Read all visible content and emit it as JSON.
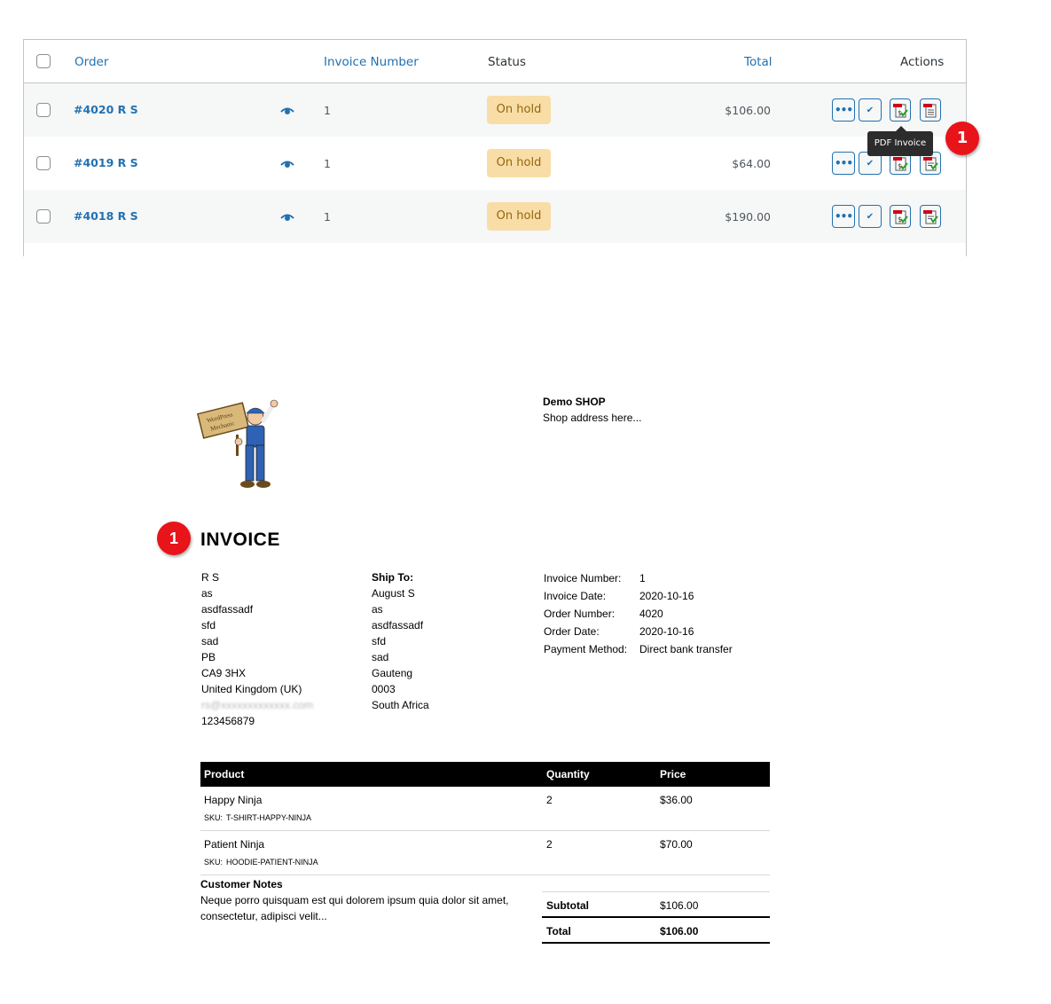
{
  "orders_table": {
    "headers": {
      "order": "Order",
      "invoice_number": "Invoice Number",
      "status": "Status",
      "total": "Total",
      "actions": "Actions"
    },
    "rows": [
      {
        "order": "#4020 R S",
        "invoice_number": "1",
        "status": "On hold",
        "total": "$106.00"
      },
      {
        "order": "#4019 R S",
        "invoice_number": "1",
        "status": "On hold",
        "total": "$64.00"
      },
      {
        "order": "#4018 R S",
        "invoice_number": "1",
        "status": "On hold",
        "total": "$190.00"
      }
    ],
    "action_icons": [
      "more-icon",
      "complete-check-icon",
      "pdf-invoice-icon",
      "pdf-packing-slip-icon"
    ],
    "tooltip": "PDF Invoice"
  },
  "annotations": {
    "marker_label": "1",
    "marker_color": "#e8141a"
  },
  "invoice": {
    "logo_text": [
      "WordPress",
      "Mechanic"
    ],
    "shop": {
      "name": "Demo SHOP",
      "address": "Shop address here..."
    },
    "title": "INVOICE",
    "billing_address": [
      "R S",
      "as",
      "asdfassadf",
      "sfd",
      "sad",
      "PB",
      "CA9 3HX",
      "United Kingdom (UK)",
      "rs@xxxxxxxxxxxxx.com",
      "123456879"
    ],
    "shipping": {
      "label": "Ship To:",
      "lines": [
        "August S",
        "as",
        "asdfassadf",
        "sfd",
        "sad",
        "Gauteng",
        "0003",
        "South Africa"
      ]
    },
    "meta": [
      {
        "label": "Invoice Number:",
        "value": "1"
      },
      {
        "label": "Invoice Date:",
        "value": "2020-10-16"
      },
      {
        "label": "Order Number:",
        "value": "4020"
      },
      {
        "label": "Order Date:",
        "value": "2020-10-16"
      },
      {
        "label": "Payment Method:",
        "value": "Direct bank transfer"
      }
    ],
    "items_headers": {
      "product": "Product",
      "quantity": "Quantity",
      "price": "Price"
    },
    "items": [
      {
        "name": "Happy Ninja",
        "sku_label": "SKU:",
        "sku": "T-SHIRT-HAPPY-NINJA",
        "quantity": "2",
        "price": "$36.00"
      },
      {
        "name": "Patient Ninja",
        "sku_label": "SKU:",
        "sku": "HOODIE-PATIENT-NINJA",
        "quantity": "2",
        "price": "$70.00"
      }
    ],
    "notes": {
      "title": "Customer Notes",
      "text": "Neque porro quisquam est qui dolorem ipsum quia dolor sit amet, consectetur, adipisci velit..."
    },
    "totals": [
      {
        "label": "Subtotal",
        "value": "$106.00"
      },
      {
        "label": "Total",
        "value": "$106.00"
      }
    ]
  }
}
